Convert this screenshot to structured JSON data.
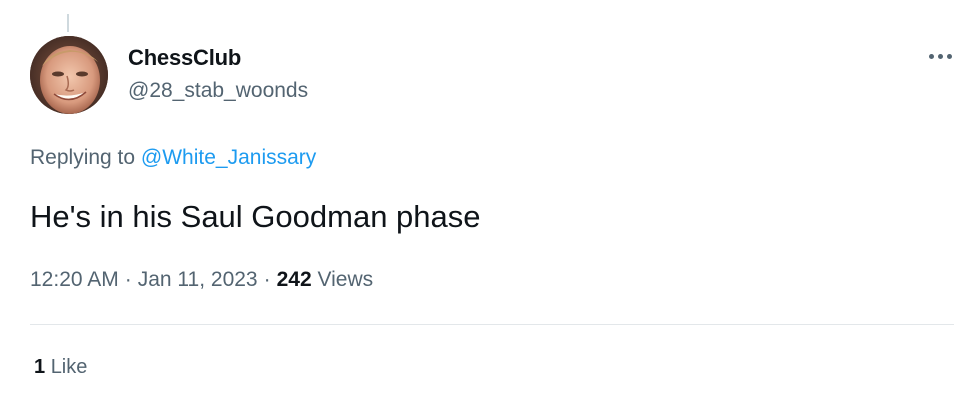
{
  "author": {
    "display_name": "ChessClub",
    "handle": "@28_stab_woonds"
  },
  "reply": {
    "prefix": "Replying to",
    "mention": "@White_Janissary"
  },
  "tweet": {
    "text": "He's in his Saul Goodman phase"
  },
  "meta": {
    "time": "12:20 AM",
    "separator": "·",
    "date": "Jan 11, 2023",
    "views_count": "242",
    "views_label": "Views"
  },
  "engagement": {
    "likes_count": "1",
    "likes_label": "Like"
  },
  "colors": {
    "link": "#1d9bf0",
    "secondary_text": "#536471",
    "primary_text": "#0f1419",
    "divider": "#e3e7ea"
  },
  "icons": {
    "more": "more-horizontal-icon"
  }
}
